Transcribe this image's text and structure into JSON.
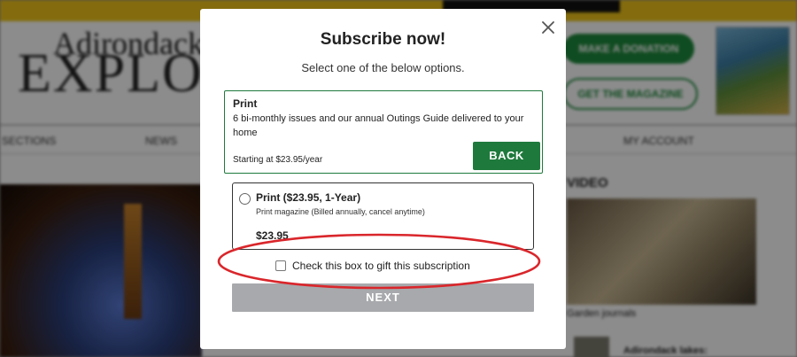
{
  "background_site": {
    "logo_line1": "Adirondack",
    "logo_line2": "EXPLORER",
    "donate_label": "MAKE A DONATION",
    "magazine_label": "GET THE MAGAZINE",
    "nav": {
      "sections": "SECTIONS",
      "news": "NEWS",
      "account": "MY ACCOUNT"
    },
    "video_label": "VIDEO",
    "video_caption": "Garden journals",
    "side_caption": "Adirondack lakes:"
  },
  "modal": {
    "title": "Subscribe now!",
    "subtitle": "Select one of the below options.",
    "close_icon": "close-icon",
    "print_card": {
      "title": "Print",
      "description": "6 bi-monthly issues and our annual Outings Guide delivered to your home",
      "price_note": "Starting at $23.95/year",
      "back_label": "BACK"
    },
    "option": {
      "title": "Print ($23.95, 1-Year)",
      "description": "Print magazine (Billed annually, cancel anytime)",
      "price": "$23.95",
      "selected": false
    },
    "gift_label": "Check this box to gift this subscription",
    "gift_checked": false,
    "next_label": "NEXT"
  },
  "colors": {
    "accent_green": "#1e7a3c",
    "highlight_red": "#d9262b",
    "disabled_gray": "#a7a9ac",
    "promo_yellow": "#f0c419"
  }
}
